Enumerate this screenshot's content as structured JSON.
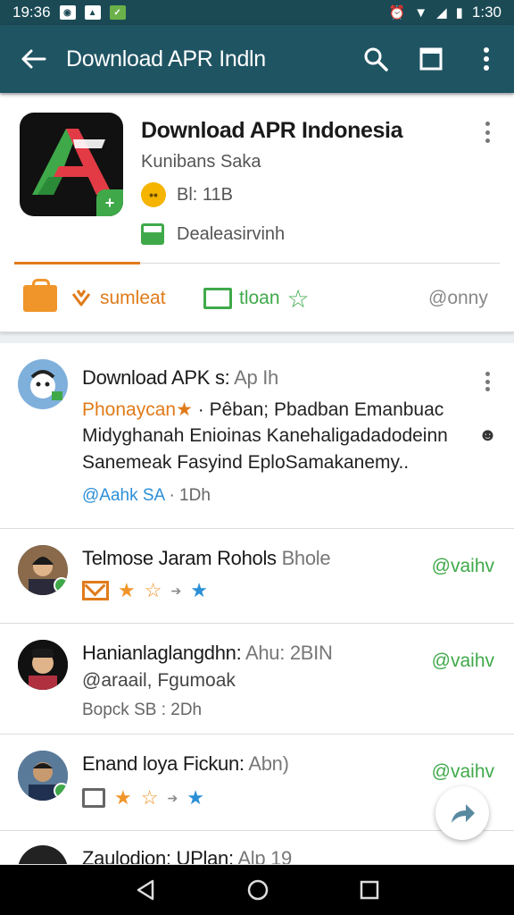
{
  "status_bar": {
    "time_left": "19:36",
    "time_right": "1:30"
  },
  "app_bar": {
    "title": "Download APR Indln"
  },
  "app_card": {
    "title": "Download APR Indonesia",
    "developer": "Kunibans Saka",
    "rating_text": "Bl: 11B",
    "installed_text": "Dealeasirvinh",
    "actions": {
      "first": "sumleat",
      "second": "tloan",
      "third": "@onny"
    }
  },
  "feed": {
    "items": [
      {
        "title": "Download APK s:",
        "title_suffix": "Ap Ih",
        "line1_highlight": "Phonaycan★",
        "line1_rest": " · Pêban; Pbadban Emanbuac",
        "line2": "Midyghanah Enioinas Kanehaligadadodeinn",
        "line3": "Sanemeak Fasyind EploSamakanemy..",
        "meta_handle": "@Aahk SA",
        "meta_time": " · 1Dh"
      },
      {
        "title": "Telmose Jaram Rohols",
        "title_suffix": "Bhole",
        "handle": "@vaihv"
      },
      {
        "title": "Hanianlaglangdhn:",
        "title_suffix": "Ahu: 2BIN",
        "line1": "@araail, Fgumoak",
        "line2": "Bopck SB : 2Dh",
        "handle": "@vaihv"
      },
      {
        "title": "Enand loya Fickun:",
        "title_suffix": "Abn)",
        "handle": "@vaihv"
      },
      {
        "title": "Zaulodion: UPlan:",
        "title_suffix": "Alp 19"
      }
    ]
  }
}
